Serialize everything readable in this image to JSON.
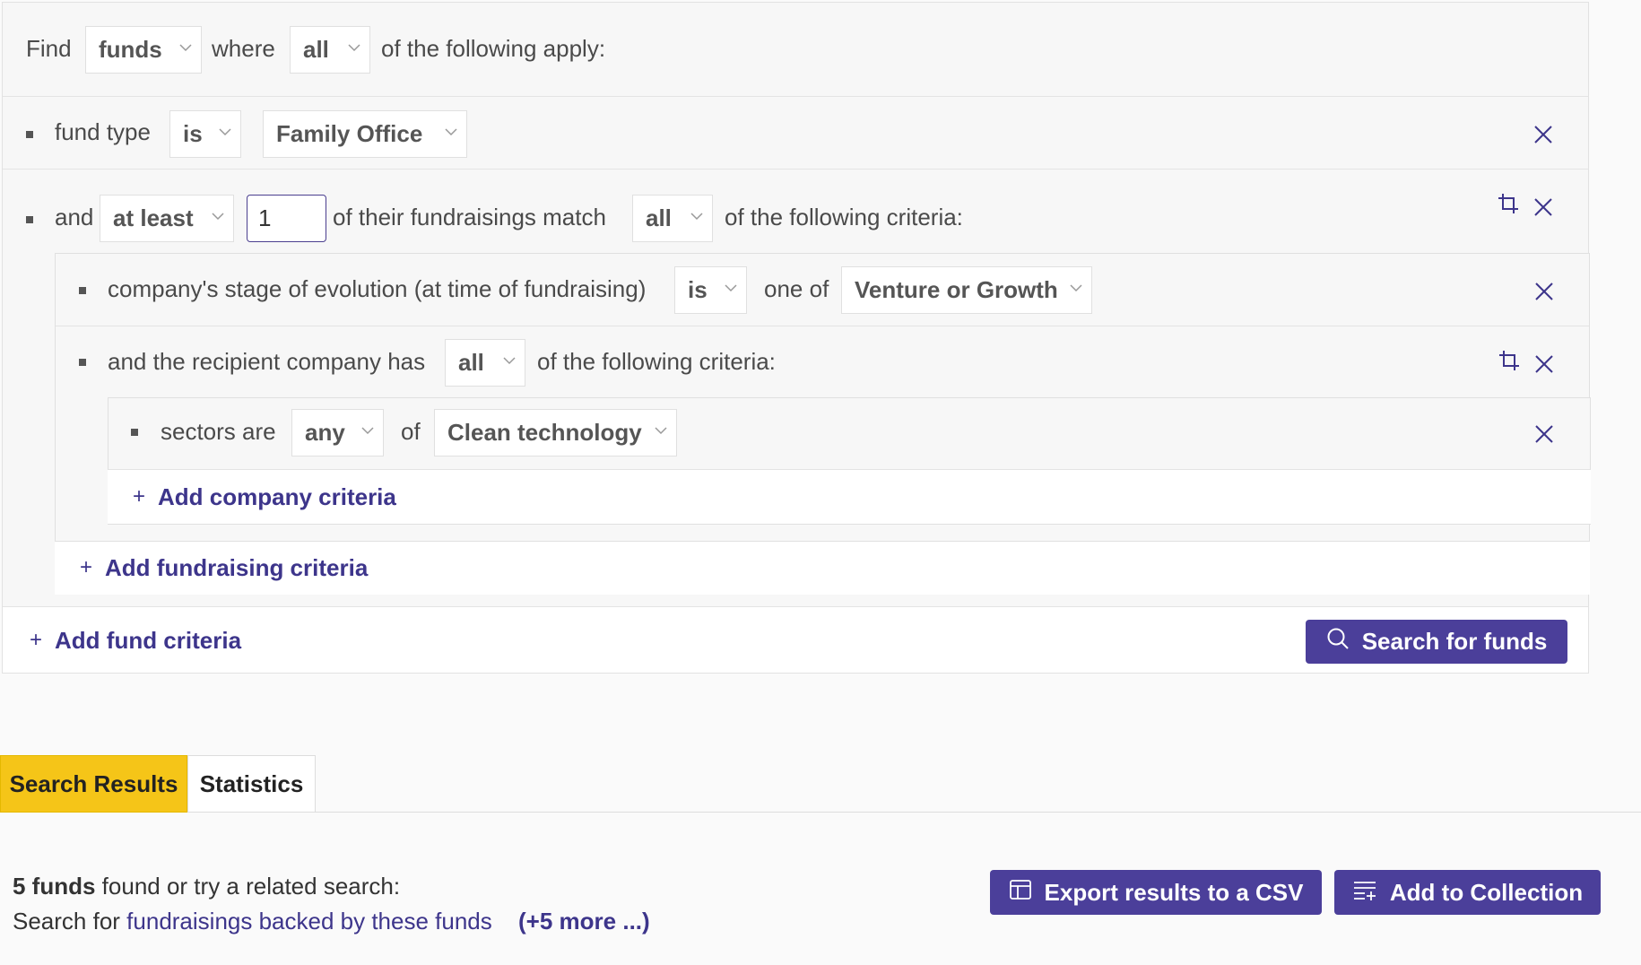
{
  "query": {
    "find_label": "Find",
    "entity": "funds",
    "where_label": "where",
    "match_mode": "all",
    "following_label": "of the following apply:"
  },
  "criteria": {
    "fund_type": {
      "field": "fund type",
      "operator": "is",
      "value": "Family Office"
    },
    "fundraisings": {
      "and_label": "and",
      "quantifier": "at least",
      "count": "1",
      "mid_label": "of their fundraisings match",
      "match_mode": "all",
      "following_label": "of the following criteria:",
      "stage": {
        "field": "company's stage of evolution (at time of fundraising)",
        "operator": "is",
        "one_of_label": "one of",
        "value": "Venture or Growth"
      },
      "company": {
        "label": "and the recipient company has",
        "match_mode": "all",
        "following_label": "of the following criteria:",
        "sectors": {
          "field": "sectors are",
          "operator": "any",
          "of_label": "of",
          "value": "Clean technology"
        },
        "add_label": "Add company criteria"
      },
      "add_label": "Add fundraising criteria"
    },
    "add_label": "Add fund criteria"
  },
  "search_button": "Search for funds",
  "tabs": [
    {
      "label": "Search Results",
      "active": true
    },
    {
      "label": "Statistics",
      "active": false
    }
  ],
  "results": {
    "count_bold": "5 funds",
    "count_rest": " found or try a related search:",
    "search_for_label": "Search for ",
    "related_link": "fundraisings backed by these funds",
    "more_link": "(+5 more ...)",
    "export_button": "Export results to a CSV",
    "collection_button": "Add to Collection"
  },
  "colors": {
    "accent": "#4b3f9a",
    "link": "#3d358b",
    "active_tab": "#f5c518"
  },
  "icons": [
    "chevron-down-icon",
    "close-icon",
    "crop-icon",
    "plus-icon",
    "search-icon",
    "table-icon",
    "list-add-icon"
  ]
}
